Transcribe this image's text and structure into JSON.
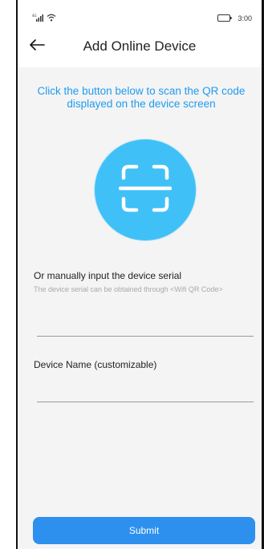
{
  "status_bar": {
    "network": "4G",
    "time": "3:00"
  },
  "header": {
    "title": "Add Online Device"
  },
  "scan": {
    "instruction": "Click the button below to scan the QR code displayed on the device screen"
  },
  "serial": {
    "label": "Or manually input the device serial",
    "hint": "The device serial can be obtained through <Wifi QR Code>",
    "value": "",
    "placeholder": ""
  },
  "device_name": {
    "label": "Device Name (customizable)",
    "value": "",
    "placeholder": ""
  },
  "actions": {
    "submit_label": "Submit"
  },
  "colors": {
    "accent": "#1e9bf0",
    "scan_circle": "#3fc1f8",
    "submit": "#2d90ef"
  },
  "icons": {
    "back": "arrow-left-icon",
    "scan": "qr-scan-icon",
    "signal": "signal-icon",
    "wifi": "wifi-icon",
    "battery": "battery-icon"
  }
}
